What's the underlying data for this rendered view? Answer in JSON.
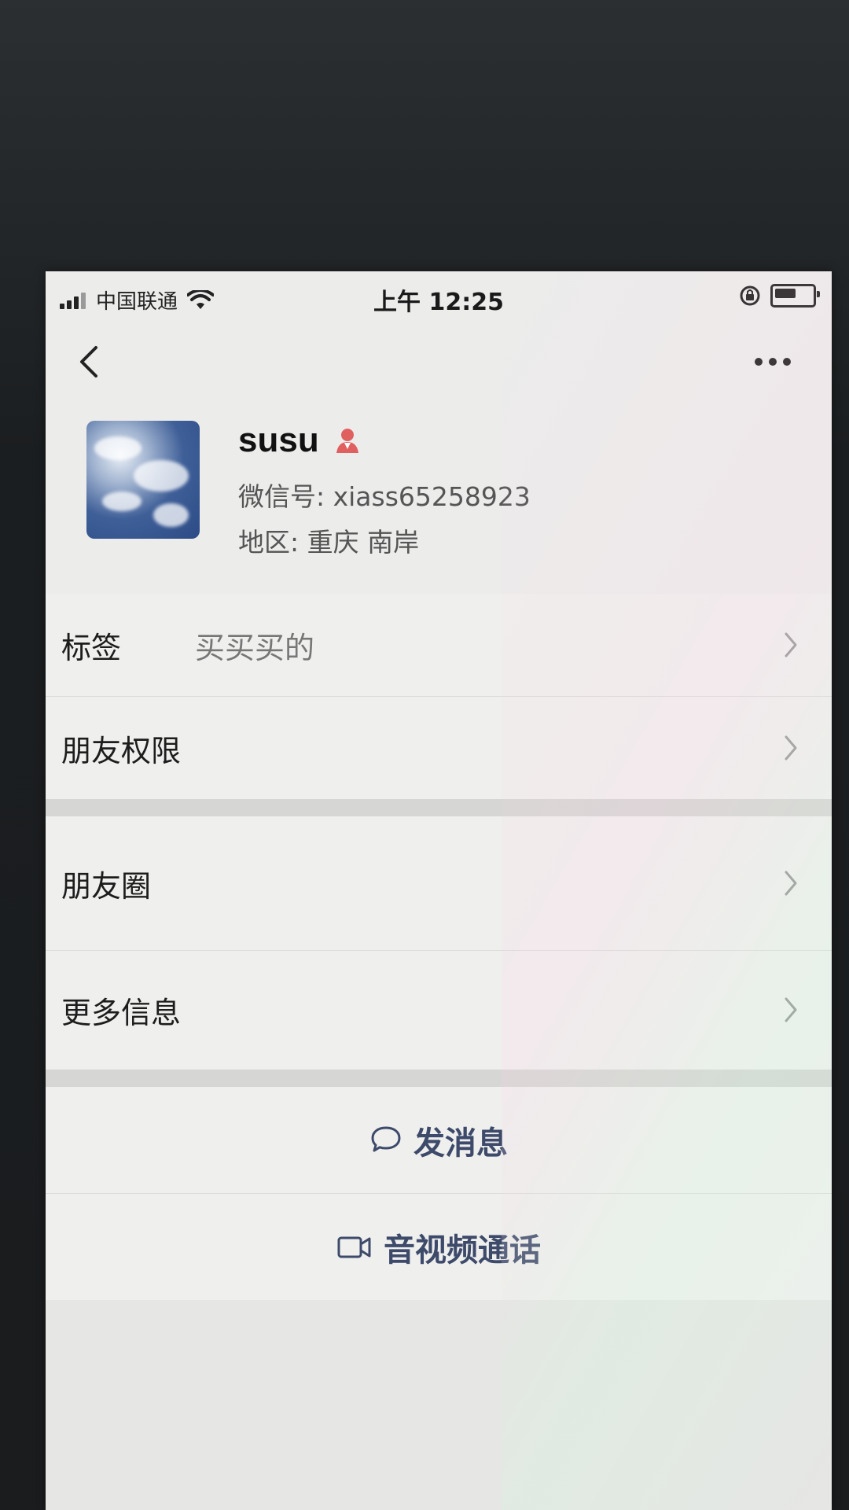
{
  "status_bar": {
    "carrier": "中国联通",
    "time": "上午 12:25"
  },
  "nav": {
    "back_icon": "chevron-left-icon",
    "more_icon": "more-dots-icon"
  },
  "profile": {
    "name": "susu",
    "wechat_id": "微信号: xiass65258923",
    "region": "地区: 重庆 南岸",
    "gender_icon": "female-icon",
    "gender_color": "#e06060"
  },
  "list_section_1": [
    {
      "label": "标签",
      "value": "买买买的"
    },
    {
      "label": "朋友权限",
      "value": ""
    }
  ],
  "list_section_2": [
    {
      "label": "朋友圈",
      "value": ""
    },
    {
      "label": "更多信息",
      "value": ""
    }
  ],
  "actions": {
    "message": "发消息",
    "call": "音视频通话"
  },
  "colors": {
    "action_text": "#3d4a6a",
    "background": "#ececeb"
  }
}
